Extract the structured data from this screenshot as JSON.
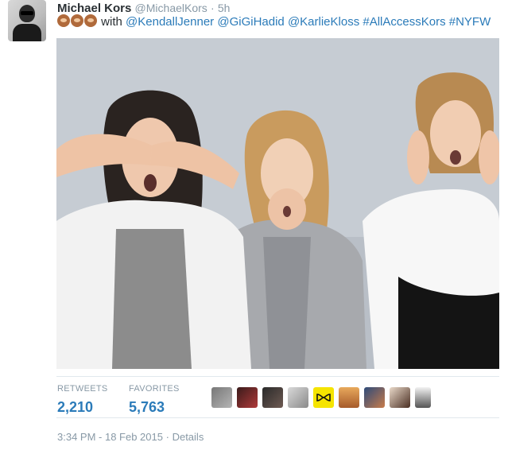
{
  "author": {
    "name": "Michael Kors",
    "handle": "@MichaelKors",
    "separator": "·",
    "time": "5h"
  },
  "tweet": {
    "emojis": [
      "see-no-evil-monkey",
      "speak-no-evil-monkey",
      "hear-no-evil-monkey"
    ],
    "prefix": "with",
    "mentions": [
      "@KendallJenner",
      "@GiGiHadid",
      "@KarlieKloss"
    ],
    "hashtags": [
      "#AllAccessKors",
      "#NYFW"
    ]
  },
  "stats": {
    "retweets_label": "RETWEETS",
    "retweets_value": "2,210",
    "favorites_label": "FAVORITES",
    "favorites_value": "5,763"
  },
  "favoriters": [
    "favoriter-avatar-1",
    "favoriter-avatar-2",
    "favoriter-avatar-3",
    "favoriter-avatar-4",
    "favoriter-avatar-5",
    "favoriter-avatar-6",
    "favoriter-avatar-7",
    "favoriter-avatar-8",
    "favoriter-avatar-9"
  ],
  "footer": {
    "timestamp": "3:34 PM - 18 Feb 2015",
    "separator": "·",
    "details_label": "Details"
  },
  "colors": {
    "link": "#2b7bb9",
    "muted": "#8899a6",
    "text": "#292f33"
  }
}
